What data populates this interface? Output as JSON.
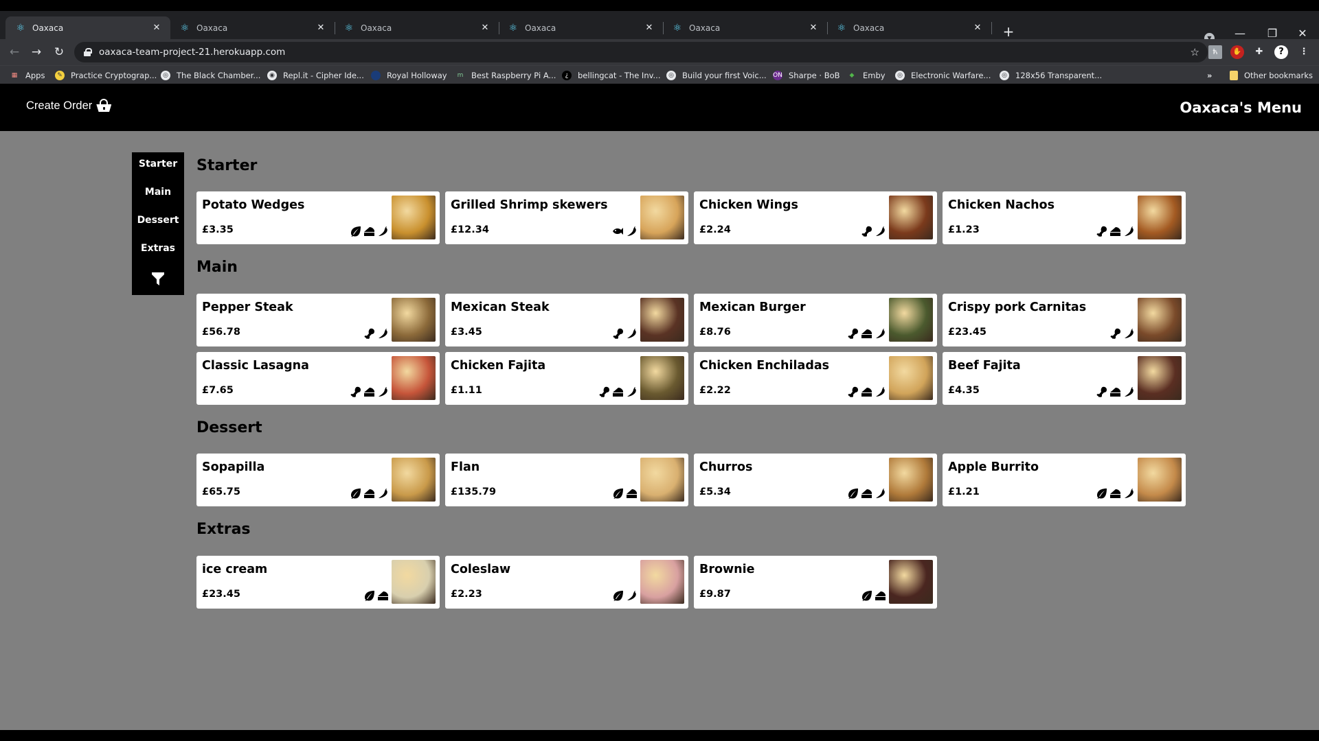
{
  "browser": {
    "tabs": [
      {
        "title": "Oaxaca",
        "active": true
      },
      {
        "title": "Oaxaca",
        "active": false
      },
      {
        "title": "Oaxaca",
        "active": false
      },
      {
        "title": "Oaxaca",
        "active": false
      },
      {
        "title": "Oaxaca",
        "active": false
      },
      {
        "title": "Oaxaca",
        "active": false
      }
    ],
    "tab_close_glyph": "✕",
    "new_tab_glyph": "+",
    "url": "oaxaca-team-project-21.herokuapp.com",
    "bookmarks": [
      {
        "label": "Apps",
        "icon": "apps-grid-icon"
      },
      {
        "label": "Practice Cryptograp...",
        "icon": "cryptography-icon"
      },
      {
        "label": "The Black Chamber...",
        "icon": "globe-icon"
      },
      {
        "label": "Repl.it - Cipher Ide...",
        "icon": "replit-icon"
      },
      {
        "label": "Royal Holloway",
        "icon": "royal-holloway-icon"
      },
      {
        "label": "Best Raspberry Pi A...",
        "icon": "m-icon"
      },
      {
        "label": "bellingcat - The Inv...",
        "icon": "bellingcat-icon"
      },
      {
        "label": "Build your first Voic...",
        "icon": "globe-icon"
      },
      {
        "label": "Sharpe · BoB",
        "icon": "on-icon"
      },
      {
        "label": "Emby",
        "icon": "emby-icon"
      },
      {
        "label": "Electronic Warfare...",
        "icon": "globe-icon"
      },
      {
        "label": "128x56 Transparent...",
        "icon": "globe-icon"
      }
    ],
    "bookmarks_overflow": "»",
    "other_bookmarks": "Other bookmarks"
  },
  "header": {
    "create_order_label": "Create Order",
    "title": "Oaxaca's Menu"
  },
  "sidebar": {
    "items": [
      {
        "label": "Starter"
      },
      {
        "label": "Main"
      },
      {
        "label": "Dessert"
      },
      {
        "label": "Extras"
      }
    ]
  },
  "colors": {
    "page_bg": "#808080",
    "header_bg": "#000000",
    "card_bg": "#ffffff"
  },
  "sections": [
    {
      "title": "Starter",
      "items": [
        {
          "name": "Potato Wedges",
          "price": "£3.35",
          "icons": [
            "leaf",
            "cheese",
            "pepper"
          ],
          "img": "#c9902e"
        },
        {
          "name": "Grilled Shrimp skewers",
          "price": "£12.34",
          "icons": [
            "fish",
            "pepper"
          ],
          "img": "#d7a45a"
        },
        {
          "name": "Chicken Wings",
          "price": "£2.24",
          "icons": [
            "meat",
            "pepper"
          ],
          "img": "#7b3a1c"
        },
        {
          "name": "Chicken Nachos",
          "price": "£1.23",
          "icons": [
            "meat",
            "cheese",
            "pepper"
          ],
          "img": "#a35a22"
        }
      ]
    },
    {
      "title": "Main",
      "items": [
        {
          "name": "Pepper Steak",
          "price": "£56.78",
          "icons": [
            "meat",
            "pepper"
          ],
          "img": "#8c6a3a"
        },
        {
          "name": "Mexican Steak",
          "price": "£3.45",
          "icons": [
            "meat",
            "pepper"
          ],
          "img": "#5a3324"
        },
        {
          "name": "Mexican Burger",
          "price": "£8.76",
          "icons": [
            "meat",
            "cheese",
            "pepper"
          ],
          "img": "#4b5a2e"
        },
        {
          "name": "Crispy pork Carnitas",
          "price": "£23.45",
          "icons": [
            "meat",
            "pepper"
          ],
          "img": "#7a4a2a"
        },
        {
          "name": "Classic Lasagna",
          "price": "£7.65",
          "icons": [
            "meat",
            "cheese",
            "pepper"
          ],
          "img": "#c6553a"
        },
        {
          "name": "Chicken Fajita",
          "price": "£1.11",
          "icons": [
            "meat",
            "cheese",
            "pepper"
          ],
          "img": "#6a5a30"
        },
        {
          "name": "Chicken Enchiladas",
          "price": "£2.22",
          "icons": [
            "meat",
            "cheese",
            "pepper"
          ],
          "img": "#d1a45a"
        },
        {
          "name": "Beef Fajita",
          "price": "£4.35",
          "icons": [
            "meat",
            "cheese",
            "pepper"
          ],
          "img": "#5a2e22"
        }
      ]
    },
    {
      "title": "Dessert",
      "items": [
        {
          "name": "Sopapilla",
          "price": "£65.75",
          "icons": [
            "leaf",
            "cheese",
            "pepper"
          ],
          "img": "#c99a4a"
        },
        {
          "name": "Flan",
          "price": "£135.79",
          "icons": [
            "leaf",
            "cheese"
          ],
          "img": "#d9b070"
        },
        {
          "name": "Churros",
          "price": "£5.34",
          "icons": [
            "leaf",
            "cheese",
            "pepper"
          ],
          "img": "#b07a3a"
        },
        {
          "name": "Apple Burrito",
          "price": "£1.21",
          "icons": [
            "leaf",
            "cheese",
            "pepper"
          ],
          "img": "#c48a4a"
        }
      ]
    },
    {
      "title": "Extras",
      "items": [
        {
          "name": "ice cream",
          "price": "£23.45",
          "icons": [
            "leaf",
            "cheese"
          ],
          "img": "#d8cfae"
        },
        {
          "name": "Coleslaw",
          "price": "£2.23",
          "icons": [
            "leaf",
            "pepper"
          ],
          "img": "#d8a0a0"
        },
        {
          "name": "Brownie",
          "price": "£9.87",
          "icons": [
            "leaf",
            "cheese"
          ],
          "img": "#4a2620"
        }
      ]
    }
  ]
}
